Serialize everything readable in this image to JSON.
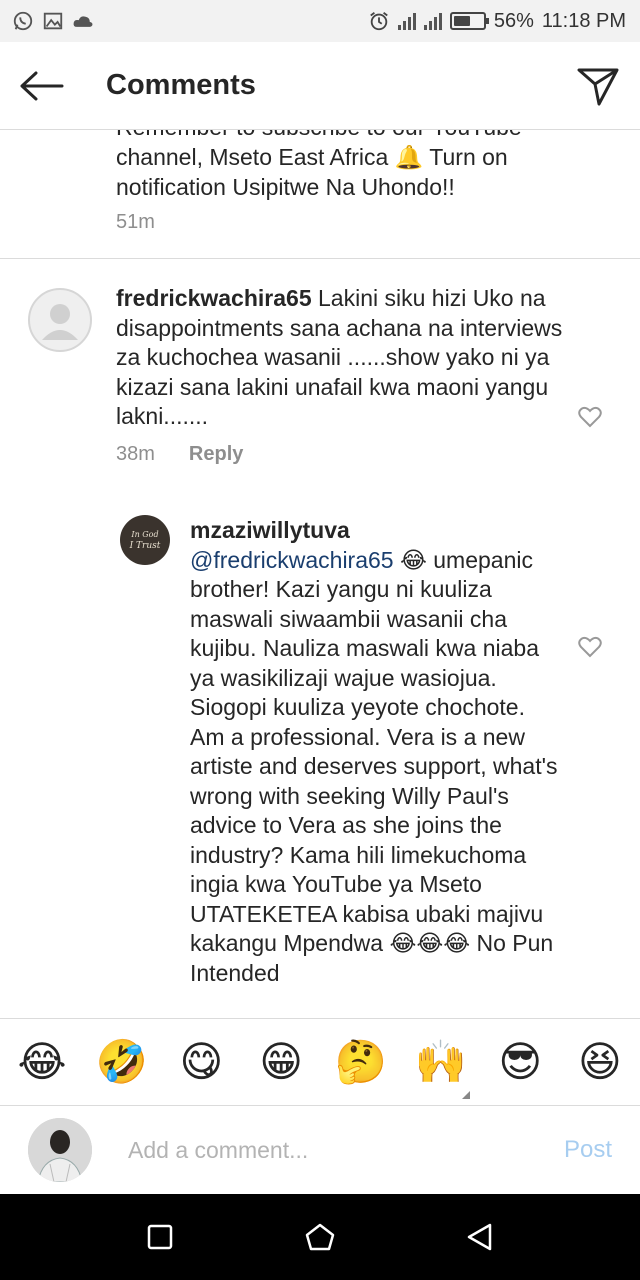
{
  "status_bar": {
    "battery_text": "56%",
    "battery_level": 0.56,
    "time": "11:18 PM",
    "icons": [
      "whatsapp-icon",
      "gallery-icon",
      "cloud-icon",
      "alarm-icon",
      "signal-icon",
      "battery-icon"
    ]
  },
  "header": {
    "title": "Comments",
    "back_icon": "arrow-left-icon",
    "share_icon": "paper-plane-icon"
  },
  "caption": {
    "text": "Remember to subscribe to our YouTube channel, Mseto East Africa 🔔 Turn on notification Usipitwe Na Uhondo!!",
    "time": "51m"
  },
  "comments": [
    {
      "username": "fredrickwachira65",
      "text": "Lakini siku hizi Uko na disappointments sana achana na interviews za kuchochea wasanii ......show yako ni ya kizazi sana lakini unafail kwa maoni yangu lakni.......",
      "time": "38m",
      "reply_label": "Reply"
    },
    {
      "username": "mzaziwillytuva",
      "mention": "@fredrickwachira65",
      "text_after_mention": "😂 umepanic brother! Kazi yangu ni kuuliza maswali siwaambii wasanii cha kujibu. Nauliza maswali kwa niaba ya wasikilizaji wajue wasiojua. Siogopi kuuliza yeyote chochote. Am a professional. Vera is a new artiste and deserves support, what's wrong with seeking Willy Paul's advice to Vera as she joins the industry? Kama hili limekuchoma ingia kwa YouTube ya Mseto UTATEKETEA kabisa ubaki majivu kakangu Mpendwa 😂😂😂 No Pun Intended",
      "avatar_text": "In God I Trust"
    }
  ],
  "emoji_bar": [
    "😂",
    "🤣",
    "😋",
    "😁",
    "🤔",
    "🙌",
    "😎",
    "😆"
  ],
  "composer": {
    "placeholder": "Add a comment...",
    "post_label": "Post"
  },
  "navbar": {
    "icons": [
      "recents-square-icon",
      "home-pentagon-icon",
      "back-triangle-icon"
    ]
  }
}
